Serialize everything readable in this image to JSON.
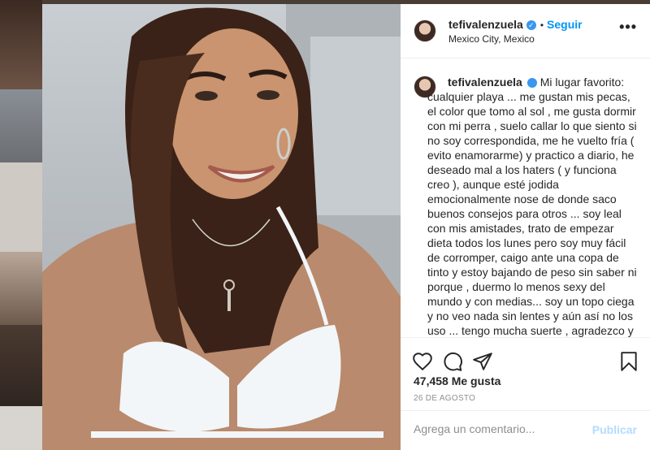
{
  "post": {
    "username": "tefivalenzuela",
    "verified": true,
    "follow_label": "Seguir",
    "separator": "•",
    "location": "Mexico City, Mexico",
    "more_label": "•••",
    "caption": "Mi lugar favorito: cualquier playa ... me gustan mis pecas, el color que tomo al sol , me gusta dormir con mi perra , suelo callar lo que siento si no soy correspondida, me he vuelto fría ( evito enamorarme) y practico a diario, he deseado mal a los haters ( y funciona creo ), aunque esté jodida emocionalmente nose de donde saco buenos consejos para otros ... soy leal con mis amistades, trato de empezar dieta todos los lunes pero soy muy fácil de corromper, caigo ante una copa de tinto y estoy bajando de peso sin saber ni porque , duermo lo menos sexy del mundo y con medias... soy un topo ciega y no veo nada sin lentes y aún así no los uso ... tengo mucha suerte , agradezco y medito en las mañanas ... imagino conversaciones",
    "likes": "47,458 Me gusta",
    "date": "26 DE AGOSTO"
  },
  "comment": {
    "placeholder": "Agrega un comentario...",
    "publish_label": "Publicar"
  },
  "icons": {
    "like": "heart-icon",
    "comment": "comment-icon",
    "share": "share-icon",
    "save": "bookmark-icon",
    "verified": "verified-badge-icon",
    "more": "more-options-icon"
  },
  "colors": {
    "accent": "#0095f6",
    "verified": "#3897f0",
    "publish_disabled": "#b3dbff",
    "text": "#262626",
    "muted": "#8e8e8e"
  }
}
